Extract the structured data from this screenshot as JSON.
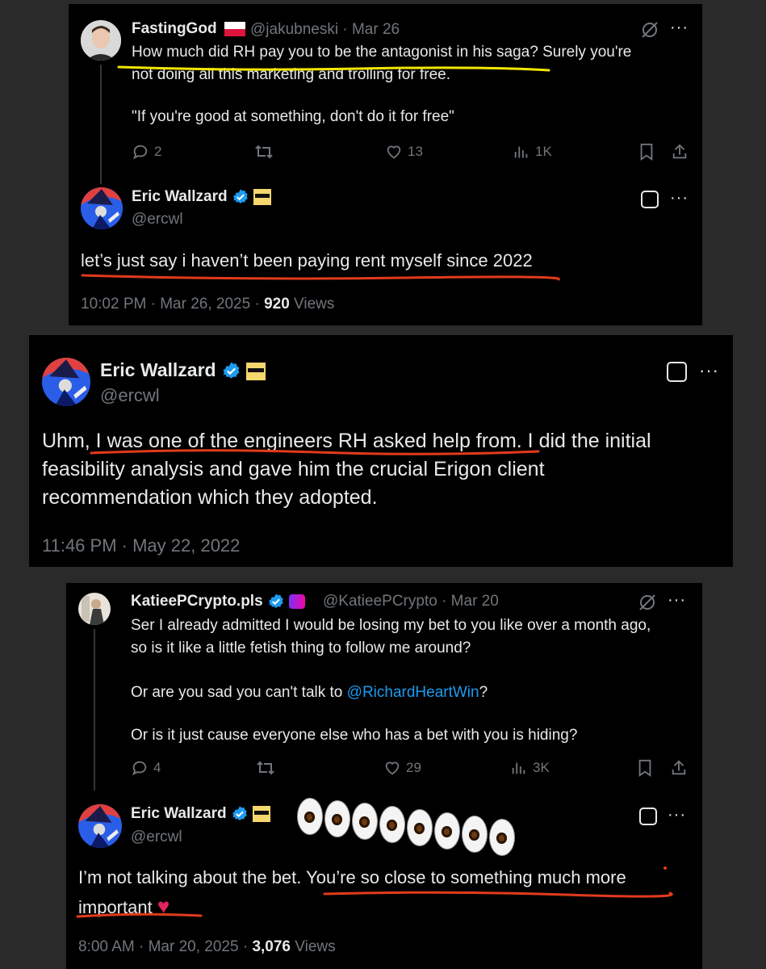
{
  "panel1": {
    "reply": {
      "name": "FastingGod",
      "flag": "🇵🇱",
      "handle": "@jakubneski",
      "date": "· Mar 26",
      "line1": "How much did RH pay you to be the antagonist in his saga? Surely you're",
      "line2": "not doing all this marketing and trolling for free.",
      "line3": "\"If you're good at something, don't do it for free\"",
      "replies": "2",
      "likes": "13",
      "views": "1K"
    },
    "main": {
      "name": "Eric Wallzard",
      "handle": "@ercwl",
      "text": "let’s just say i haven’t been paying rent myself since 2022",
      "timestamp": "10:02 PM · Mar 26, 2025 ·",
      "views_count": "920",
      "views_label": "Views"
    }
  },
  "panel2": {
    "name": "Eric Wallzard",
    "handle": "@ercwl",
    "line1": "Uhm, I was one of the engineers RH asked help from. I did the initial",
    "line2": "feasibility analysis and gave him the crucial Erigon client",
    "line3": "recommendation which they adopted.",
    "timestamp": "11:46 PM · May 22, 2022"
  },
  "panel3": {
    "reply": {
      "name": "KatieePCrypto.pls",
      "handle": "@KatieePCrypto",
      "date": "· Mar 20",
      "line1": "Ser I already admitted I would be losing my bet to you like over a month ago,",
      "line2": "so is it like a little fetish thing to follow me around?",
      "line3_pre": "Or are you sad you can't talk to ",
      "line3_mention": "@RichardHeartWin",
      "line3_post": "?",
      "line4": "Or is it just cause everyone else who has a bet with you is hiding?",
      "replies": "4",
      "likes": "29",
      "views": "3K"
    },
    "main": {
      "name": "Eric Wallzard",
      "handle": "@ercwl",
      "line1": "I’m not talking about the bet. You’re so close to something much more",
      "line2": "important",
      "heart": "♥",
      "timestamp": "8:00 AM · Mar 20, 2025 ·",
      "views_count": "3,076",
      "views_label": "Views"
    }
  },
  "icons": {
    "verified": "verified-badge-icon",
    "more": "···",
    "accent_blue": "#1d9bf0",
    "underline_red": "#e23b1b",
    "underline_yellow": "#f2e600"
  }
}
